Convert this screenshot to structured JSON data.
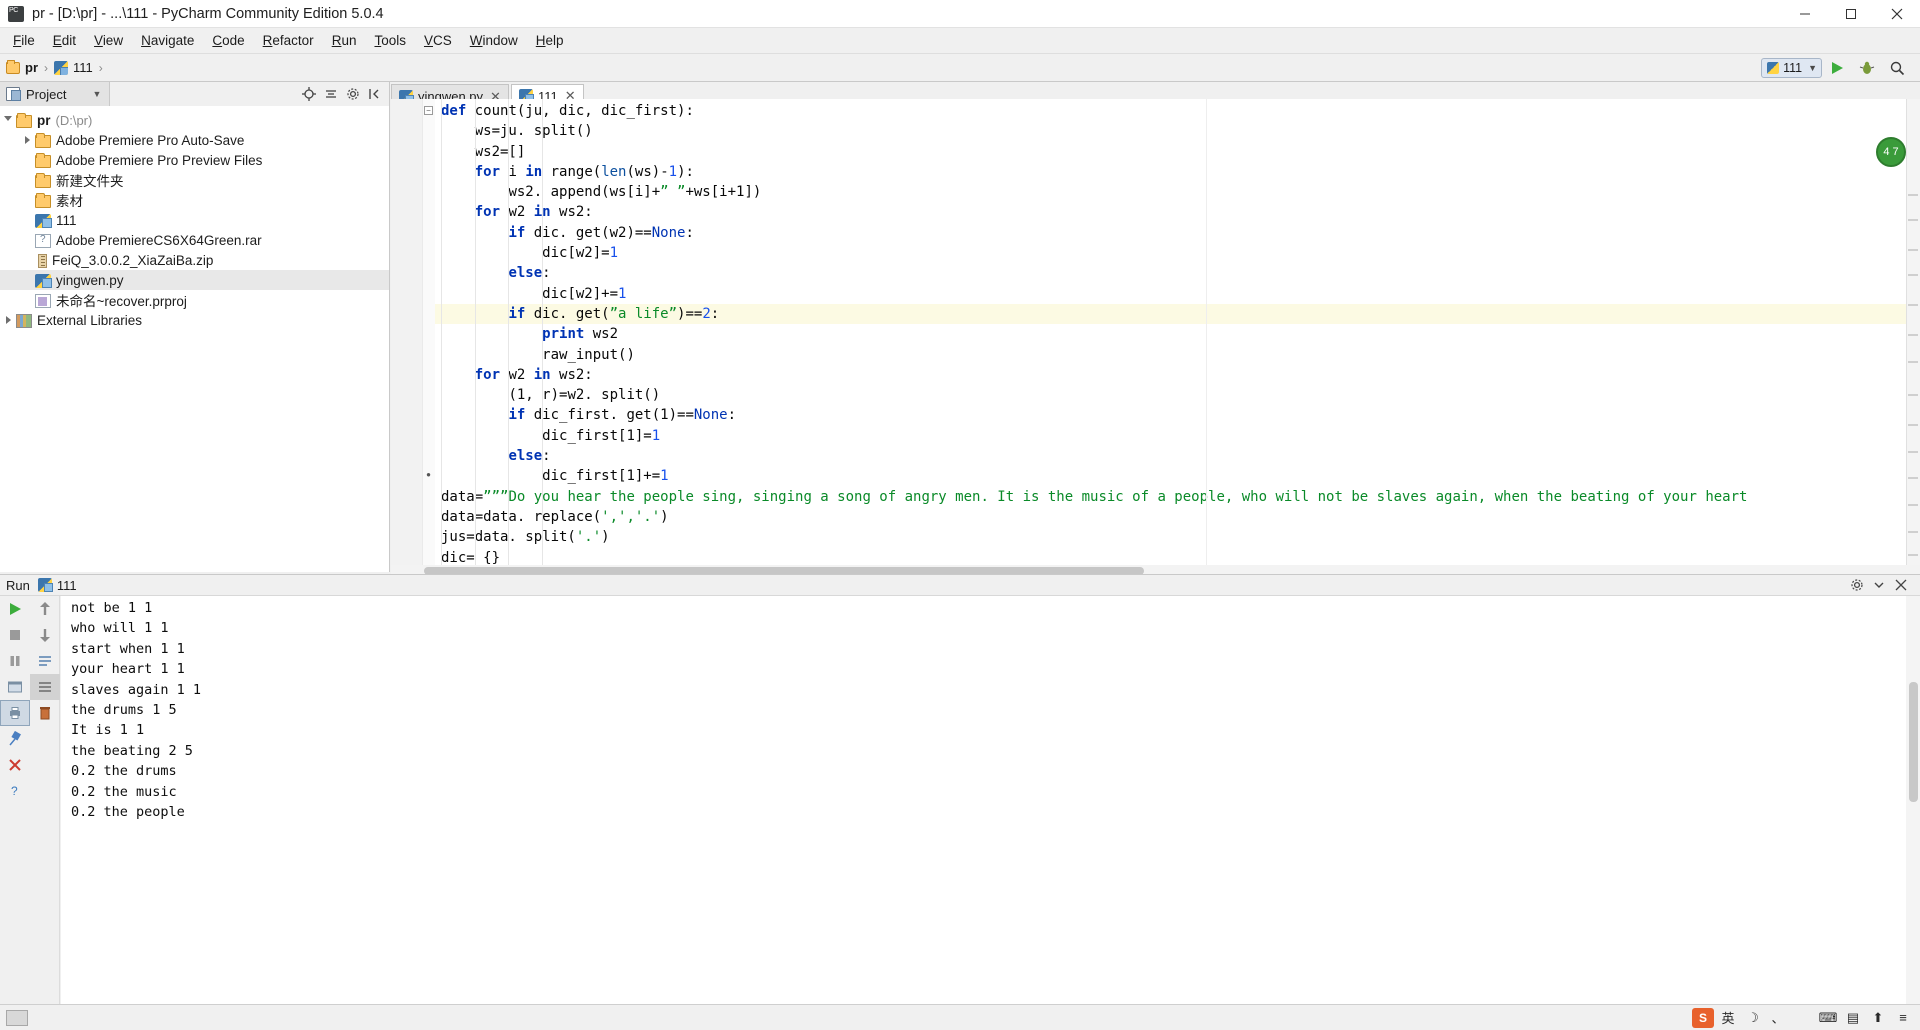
{
  "window": {
    "title": "pr - [D:\\pr] - ...\\111 - PyCharm Community Edition 5.0.4",
    "icon": "pycharm-icon",
    "minimize": "—",
    "maximize": "❑",
    "close": "✕"
  },
  "menubar": {
    "items": [
      "File",
      "Edit",
      "View",
      "Navigate",
      "Code",
      "Refactor",
      "Run",
      "Tools",
      "VCS",
      "Window",
      "Help"
    ]
  },
  "navbar": {
    "breadcrumb": [
      {
        "label": "pr",
        "icon": "folder-icon"
      },
      {
        "label": "111",
        "icon": "python-file-icon"
      }
    ],
    "separator": "›",
    "run_config": "111",
    "run_button": "run-icon",
    "debug_button": "debug-icon",
    "search_button": "search-icon"
  },
  "project_panel": {
    "tab_label": "Project",
    "tools": [
      "target-icon",
      "collapse-all-icon",
      "settings-icon",
      "hide-icon"
    ],
    "tree": [
      {
        "label": "pr",
        "path": "(D:\\pr)",
        "icon": "folder-icon",
        "depth": 0,
        "twisty": "down",
        "bold": true,
        "selected": false
      },
      {
        "label": "Adobe Premiere Pro Auto-Save",
        "path": "",
        "icon": "folder-icon",
        "depth": 1,
        "twisty": "right",
        "bold": false,
        "selected": false
      },
      {
        "label": "Adobe Premiere Pro Preview Files",
        "path": "",
        "icon": "folder-icon",
        "depth": 1,
        "twisty": "none",
        "bold": false,
        "selected": false
      },
      {
        "label": "新建文件夹",
        "path": "",
        "icon": "folder-icon",
        "depth": 1,
        "twisty": "none",
        "bold": false,
        "selected": false
      },
      {
        "label": "素材",
        "path": "",
        "icon": "folder-icon",
        "depth": 1,
        "twisty": "none",
        "bold": false,
        "selected": false
      },
      {
        "label": "111",
        "path": "",
        "icon": "python-file-icon",
        "depth": 1,
        "twisty": "none",
        "bold": false,
        "selected": false
      },
      {
        "label": "Adobe PremiereCS6X64Green.rar",
        "path": "",
        "icon": "rar-file-icon",
        "depth": 1,
        "twisty": "none",
        "bold": false,
        "selected": false
      },
      {
        "label": "FeiQ_3.0.0.2_XiaZaiBa.zip",
        "path": "",
        "icon": "zip-file-icon",
        "depth": 1,
        "twisty": "none",
        "bold": false,
        "selected": false
      },
      {
        "label": "yingwen.py",
        "path": "",
        "icon": "python-file-icon",
        "depth": 1,
        "twisty": "none",
        "bold": false,
        "selected": true
      },
      {
        "label": "未命名~recover.prproj",
        "path": "",
        "icon": "prproj-file-icon",
        "depth": 1,
        "twisty": "none",
        "bold": false,
        "selected": false
      },
      {
        "label": "External Libraries",
        "path": "",
        "icon": "library-icon",
        "depth": 0,
        "twisty": "right",
        "bold": false,
        "selected": false
      }
    ]
  },
  "editor": {
    "tabs": [
      {
        "label": "yingwen.py",
        "active": false,
        "close": "✕",
        "icon": "python-file-icon"
      },
      {
        "label": "111",
        "active": true,
        "close": "✕",
        "icon": "python-file-icon"
      }
    ],
    "inspection_badge": "4 7",
    "lines": [
      {
        "indent": 0,
        "highlight": false,
        "tokens": [
          {
            "t": "def",
            "c": "kw"
          },
          {
            "t": " count",
            "c": "cdef"
          },
          {
            "t": "(ju, dic, dic_first):",
            "c": "cdef"
          }
        ]
      },
      {
        "indent": 1,
        "highlight": false,
        "tokens": [
          {
            "t": "ws=ju. split()",
            "c": "cdef"
          }
        ]
      },
      {
        "indent": 1,
        "highlight": false,
        "tokens": [
          {
            "t": "ws2=[]",
            "c": "cdef"
          }
        ]
      },
      {
        "indent": 1,
        "highlight": false,
        "tokens": [
          {
            "t": "for",
            "c": "kw"
          },
          {
            "t": " i ",
            "c": "cdef"
          },
          {
            "t": "in",
            "c": "kw"
          },
          {
            "t": " range(",
            "c": "cdef"
          },
          {
            "t": "len",
            "c": "bi"
          },
          {
            "t": "(ws)-",
            "c": "cdef"
          },
          {
            "t": "1",
            "c": "num"
          },
          {
            "t": "):",
            "c": "cdef"
          }
        ]
      },
      {
        "indent": 2,
        "highlight": false,
        "tokens": [
          {
            "t": "ws2. append(ws[i]+",
            "c": "cdef"
          },
          {
            "t": "” ”",
            "c": "str"
          },
          {
            "t": "+ws[i+1])",
            "c": "cdef"
          }
        ]
      },
      {
        "indent": 1,
        "highlight": false,
        "tokens": [
          {
            "t": "for",
            "c": "kw"
          },
          {
            "t": " w2 ",
            "c": "cdef"
          },
          {
            "t": "in",
            "c": "kw"
          },
          {
            "t": " ws2:",
            "c": "cdef"
          }
        ]
      },
      {
        "indent": 2,
        "highlight": false,
        "tokens": [
          {
            "t": "if",
            "c": "kw"
          },
          {
            "t": " dic. get(w2)==",
            "c": "cdef"
          },
          {
            "t": "None",
            "c": "cnone"
          },
          {
            "t": ":",
            "c": "cdef"
          }
        ]
      },
      {
        "indent": 3,
        "highlight": false,
        "tokens": [
          {
            "t": "dic[w2]=",
            "c": "cdef"
          },
          {
            "t": "1",
            "c": "num"
          }
        ]
      },
      {
        "indent": 2,
        "highlight": false,
        "tokens": [
          {
            "t": "else",
            "c": "kw"
          },
          {
            "t": ":",
            "c": "cdef"
          }
        ]
      },
      {
        "indent": 3,
        "highlight": false,
        "tokens": [
          {
            "t": "dic[w2]+=",
            "c": "cdef"
          },
          {
            "t": "1",
            "c": "num"
          }
        ]
      },
      {
        "indent": 2,
        "highlight": true,
        "tokens": [
          {
            "t": "if",
            "c": "kw"
          },
          {
            "t": " dic. get(",
            "c": "cdef"
          },
          {
            "t": "”a life”",
            "c": "str"
          },
          {
            "t": ")==",
            "c": "cdef"
          },
          {
            "t": "2",
            "c": "num"
          },
          {
            "t": ":",
            "c": "cdef"
          }
        ]
      },
      {
        "indent": 3,
        "highlight": false,
        "tokens": [
          {
            "t": "print",
            "c": "kw"
          },
          {
            "t": " ws2",
            "c": "cdef"
          }
        ]
      },
      {
        "indent": 3,
        "highlight": false,
        "tokens": [
          {
            "t": "raw_input()",
            "c": "cdef"
          }
        ]
      },
      {
        "indent": 1,
        "highlight": false,
        "tokens": [
          {
            "t": "for",
            "c": "kw"
          },
          {
            "t": " w2 ",
            "c": "cdef"
          },
          {
            "t": "in",
            "c": "kw"
          },
          {
            "t": " ws2:",
            "c": "cdef"
          }
        ]
      },
      {
        "indent": 2,
        "highlight": false,
        "tokens": [
          {
            "t": "(1, r)=w2. split()",
            "c": "cdef"
          }
        ]
      },
      {
        "indent": 2,
        "highlight": false,
        "tokens": [
          {
            "t": "if",
            "c": "kw"
          },
          {
            "t": " dic_first. get(1)==",
            "c": "cdef"
          },
          {
            "t": "None",
            "c": "cnone"
          },
          {
            "t": ":",
            "c": "cdef"
          }
        ]
      },
      {
        "indent": 3,
        "highlight": false,
        "tokens": [
          {
            "t": "dic_first[1]=",
            "c": "cdef"
          },
          {
            "t": "1",
            "c": "num"
          }
        ]
      },
      {
        "indent": 2,
        "highlight": false,
        "tokens": [
          {
            "t": "else",
            "c": "kw"
          },
          {
            "t": ":",
            "c": "cdef"
          }
        ]
      },
      {
        "indent": 3,
        "highlight": false,
        "tokens": [
          {
            "t": "dic_first[1]+=",
            "c": "cdef"
          },
          {
            "t": "1",
            "c": "num"
          }
        ]
      },
      {
        "indent": 0,
        "highlight": false,
        "tokens": [
          {
            "t": "data=",
            "c": "cdef"
          },
          {
            "t": "”””Do you hear the people sing, singing a song of angry men. It is the music of a people, who will not be slaves again, when the beating of your heart",
            "c": "str"
          }
        ]
      },
      {
        "indent": 0,
        "highlight": false,
        "tokens": [
          {
            "t": "data=data. replace(",
            "c": "cdef"
          },
          {
            "t": "',','.'",
            "c": "str"
          },
          {
            "t": ")",
            "c": "cdef"
          }
        ]
      },
      {
        "indent": 0,
        "highlight": false,
        "tokens": [
          {
            "t": "jus=data. split(",
            "c": "cdef"
          },
          {
            "t": "'.'",
            "c": "str"
          },
          {
            "t": ")",
            "c": "cdef"
          }
        ]
      },
      {
        "indent": 0,
        "highlight": false,
        "tokens": [
          {
            "t": "dic= {}",
            "c": "cdef"
          }
        ]
      }
    ]
  },
  "run_panel": {
    "title": "Run",
    "config_name": "111",
    "settings_icon": "settings-icon",
    "hide_icon": "hide-icon",
    "side_buttons": [
      "rerun-icon",
      "stop-icon",
      "pause-icon",
      "print-icon",
      "console-icon",
      "pin-icon",
      "close-icon",
      "help-icon"
    ],
    "side_buttons2": [
      "up-icon",
      "down-icon",
      "soft-wrap-icon",
      "scroll-end-icon",
      "trash-icon"
    ],
    "output": [
      "not be 1 1",
      "who will 1 1",
      "start when 1 1",
      "your heart 1 1",
      "slaves again 1 1",
      "the drums 1 5",
      "It is 1 1",
      "the beating 2 5",
      "0.2 the drums",
      "0.2 the music",
      "0.2 the people"
    ]
  },
  "statusbar": {
    "tray": [
      {
        "name": "sogou-icon",
        "glyph": "S"
      },
      {
        "name": "ime-lang-icon",
        "glyph": "英"
      },
      {
        "name": "moon-icon",
        "glyph": "☽"
      },
      {
        "name": "comma-icon",
        "glyph": "、"
      },
      {
        "name": "microphone-icon",
        "glyph": "\u0001"
      },
      {
        "name": "keyboard-icon",
        "glyph": "⌨"
      },
      {
        "name": "toolbox-icon",
        "glyph": "▤"
      },
      {
        "name": "upload-icon",
        "glyph": "⬆"
      },
      {
        "name": "menu-icon",
        "glyph": "≡"
      }
    ]
  }
}
